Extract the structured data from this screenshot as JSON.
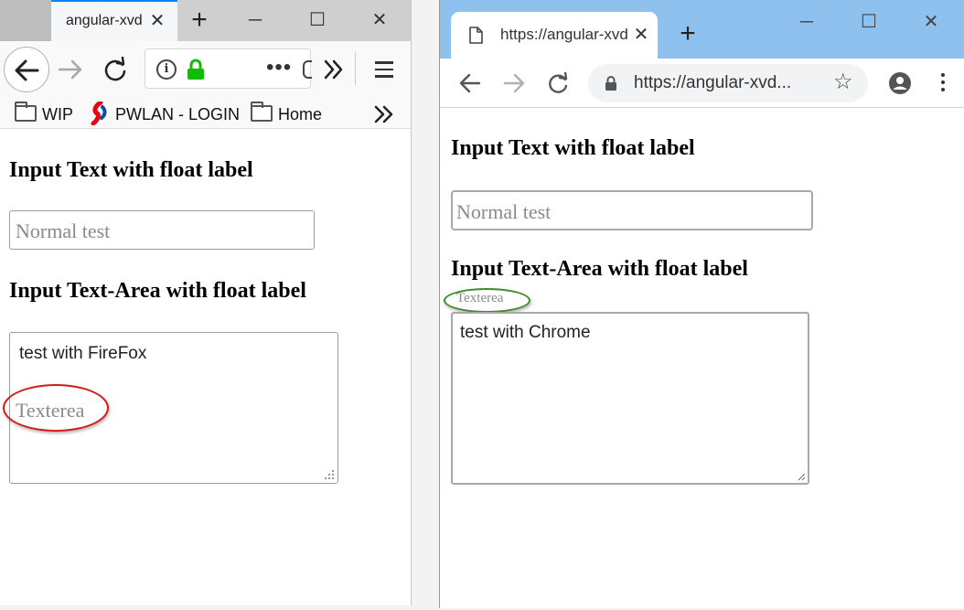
{
  "firefox": {
    "tab_title": "angular-xvd",
    "close_tab": "✕",
    "new_tab": "+",
    "minimize": "─",
    "maximize": "☐",
    "close_window": "✕",
    "url_more_dots": "•••",
    "bookmarks": [
      {
        "label": "WIP",
        "icon": "folder-icon"
      },
      {
        "label": "PWLAN - LOGIN",
        "icon": "pwlan-icon"
      },
      {
        "label": "Home",
        "icon": "folder-icon"
      }
    ],
    "page": {
      "heading_input": "Input Text with float label",
      "input_placeholder": "Normal test",
      "heading_textarea": "Input Text-Area with float label",
      "textarea_value": "test with FireFox",
      "textarea_label": "Texterea"
    },
    "annotation_color": "#d21b1b"
  },
  "chrome": {
    "tab_title": "https://angular-xvd",
    "close_tab": "✕",
    "new_tab": "+",
    "minimize": "─",
    "maximize": "☐",
    "close_window": "✕",
    "url": "https://angular-xvd...",
    "bookmark_star": "☆",
    "page": {
      "heading_input": "Input Text with float label",
      "input_placeholder": "Normal test",
      "heading_textarea": "Input Text-Area with float label",
      "textarea_label": "Texterea",
      "textarea_value": "test with Chrome"
    },
    "annotation_color": "#3d8b2a",
    "tabbar_color": "#8ec1ee"
  }
}
